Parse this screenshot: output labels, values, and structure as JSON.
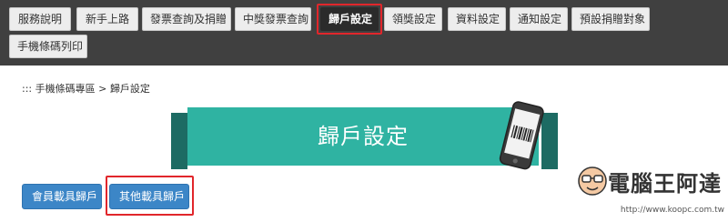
{
  "nav": {
    "items": [
      {
        "label": "服務說明"
      },
      {
        "label": "新手上路"
      },
      {
        "label": "發票查詢及捐贈"
      },
      {
        "label": "中獎發票查詢"
      },
      {
        "label": "歸戶設定"
      },
      {
        "label": "領獎設定"
      },
      {
        "label": "資料設定"
      },
      {
        "label": "通知設定"
      },
      {
        "label": "預設捐贈對象"
      },
      {
        "label": "手機條碼列印"
      }
    ],
    "active": "歸戶設定"
  },
  "breadcrumb": {
    "text": "::: 手機條碼專區 > 歸戶設定"
  },
  "banner": {
    "title": "歸戶設定"
  },
  "buttons": {
    "member_carrier": "會員載具歸戶",
    "other_carrier": "其他載具歸戶"
  },
  "watermark": {
    "brand": "電腦王阿達",
    "url": "http://www.koopc.com.tw"
  },
  "colors": {
    "nav_bg": "#404040",
    "banner_bg": "#2fb3a2",
    "button_bg": "#3c86c7",
    "highlight": "#e1262b"
  }
}
